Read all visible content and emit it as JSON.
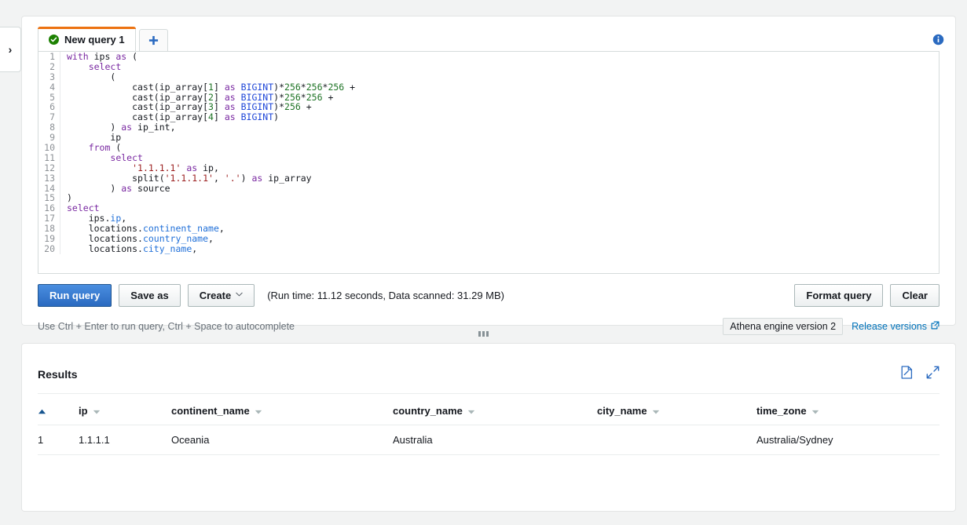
{
  "left_rail": {
    "icon": "chevron-right-icon",
    "label": "›"
  },
  "editor": {
    "info_icon": "info-circle-icon",
    "tabs": [
      {
        "label": "New query 1",
        "status_icon": "check-circle-icon",
        "active": true
      }
    ],
    "add_tab": {
      "icon": "plus-icon",
      "label": "+"
    },
    "code_lines": [
      {
        "n": "1",
        "tokens": [
          {
            "t": "with ",
            "c": "kw"
          },
          {
            "t": "ips ",
            "c": ""
          },
          {
            "t": "as",
            "c": "kw"
          },
          {
            "t": " (",
            "c": ""
          }
        ]
      },
      {
        "n": "2",
        "tokens": [
          {
            "t": "    ",
            "c": ""
          },
          {
            "t": "select",
            "c": "kw"
          }
        ]
      },
      {
        "n": "3",
        "tokens": [
          {
            "t": "        (",
            "c": ""
          }
        ]
      },
      {
        "n": "4",
        "tokens": [
          {
            "t": "            cast(ip_array[",
            "c": ""
          },
          {
            "t": "1",
            "c": "num"
          },
          {
            "t": "] ",
            "c": ""
          },
          {
            "t": "as",
            "c": "kw"
          },
          {
            "t": " ",
            "c": ""
          },
          {
            "t": "BIGINT",
            "c": "typ"
          },
          {
            "t": ")*",
            "c": ""
          },
          {
            "t": "256",
            "c": "num"
          },
          {
            "t": "*",
            "c": ""
          },
          {
            "t": "256",
            "c": "num"
          },
          {
            "t": "*",
            "c": ""
          },
          {
            "t": "256",
            "c": "num"
          },
          {
            "t": " +",
            "c": ""
          }
        ]
      },
      {
        "n": "5",
        "tokens": [
          {
            "t": "            cast(ip_array[",
            "c": ""
          },
          {
            "t": "2",
            "c": "num"
          },
          {
            "t": "] ",
            "c": ""
          },
          {
            "t": "as",
            "c": "kw"
          },
          {
            "t": " ",
            "c": ""
          },
          {
            "t": "BIGINT",
            "c": "typ"
          },
          {
            "t": ")*",
            "c": ""
          },
          {
            "t": "256",
            "c": "num"
          },
          {
            "t": "*",
            "c": ""
          },
          {
            "t": "256",
            "c": "num"
          },
          {
            "t": " +",
            "c": ""
          }
        ]
      },
      {
        "n": "6",
        "tokens": [
          {
            "t": "            cast(ip_array[",
            "c": ""
          },
          {
            "t": "3",
            "c": "num"
          },
          {
            "t": "] ",
            "c": ""
          },
          {
            "t": "as",
            "c": "kw"
          },
          {
            "t": " ",
            "c": ""
          },
          {
            "t": "BIGINT",
            "c": "typ"
          },
          {
            "t": ")*",
            "c": ""
          },
          {
            "t": "256",
            "c": "num"
          },
          {
            "t": " +",
            "c": ""
          }
        ]
      },
      {
        "n": "7",
        "tokens": [
          {
            "t": "            cast(ip_array[",
            "c": ""
          },
          {
            "t": "4",
            "c": "num"
          },
          {
            "t": "] ",
            "c": ""
          },
          {
            "t": "as",
            "c": "kw"
          },
          {
            "t": " ",
            "c": ""
          },
          {
            "t": "BIGINT",
            "c": "typ"
          },
          {
            "t": ")",
            "c": ""
          }
        ]
      },
      {
        "n": "8",
        "tokens": [
          {
            "t": "        ) ",
            "c": ""
          },
          {
            "t": "as",
            "c": "kw"
          },
          {
            "t": " ip_int,",
            "c": ""
          }
        ]
      },
      {
        "n": "9",
        "tokens": [
          {
            "t": "        ip",
            "c": ""
          }
        ]
      },
      {
        "n": "10",
        "tokens": [
          {
            "t": "    ",
            "c": ""
          },
          {
            "t": "from",
            "c": "kw"
          },
          {
            "t": " (",
            "c": ""
          }
        ]
      },
      {
        "n": "11",
        "tokens": [
          {
            "t": "        ",
            "c": ""
          },
          {
            "t": "select",
            "c": "kw"
          }
        ]
      },
      {
        "n": "12",
        "tokens": [
          {
            "t": "            ",
            "c": ""
          },
          {
            "t": "'1.1.1.1'",
            "c": "str"
          },
          {
            "t": " ",
            "c": ""
          },
          {
            "t": "as",
            "c": "kw"
          },
          {
            "t": " ip,",
            "c": ""
          }
        ]
      },
      {
        "n": "13",
        "tokens": [
          {
            "t": "            split(",
            "c": ""
          },
          {
            "t": "'1.1.1.1'",
            "c": "str"
          },
          {
            "t": ", ",
            "c": ""
          },
          {
            "t": "'.'",
            "c": "str"
          },
          {
            "t": ") ",
            "c": ""
          },
          {
            "t": "as",
            "c": "kw"
          },
          {
            "t": " ip_array",
            "c": ""
          }
        ]
      },
      {
        "n": "14",
        "tokens": [
          {
            "t": "        ) ",
            "c": ""
          },
          {
            "t": "as",
            "c": "kw"
          },
          {
            "t": " source",
            "c": ""
          }
        ]
      },
      {
        "n": "15",
        "tokens": [
          {
            "t": ")",
            "c": ""
          }
        ]
      },
      {
        "n": "16",
        "tokens": [
          {
            "t": "select",
            "c": "kw"
          }
        ]
      },
      {
        "n": "17",
        "tokens": [
          {
            "t": "    ips.",
            "c": ""
          },
          {
            "t": "ip",
            "c": "fld"
          },
          {
            "t": ",",
            "c": ""
          }
        ]
      },
      {
        "n": "18",
        "tokens": [
          {
            "t": "    locations.",
            "c": ""
          },
          {
            "t": "continent_name",
            "c": "fld"
          },
          {
            "t": ",",
            "c": ""
          }
        ]
      },
      {
        "n": "19",
        "tokens": [
          {
            "t": "    locations.",
            "c": ""
          },
          {
            "t": "country_name",
            "c": "fld"
          },
          {
            "t": ",",
            "c": ""
          }
        ]
      },
      {
        "n": "20",
        "tokens": [
          {
            "t": "    locations.",
            "c": ""
          },
          {
            "t": "city_name",
            "c": "fld"
          },
          {
            "t": ",",
            "c": ""
          }
        ]
      }
    ],
    "buttons": {
      "run": "Run query",
      "save_as": "Save as",
      "create": "Create",
      "create_caret": "ˇ",
      "format_query": "Format query",
      "clear": "Clear"
    },
    "run_stats": "(Run time: 11.12 seconds, Data scanned: 31.29 MB)",
    "hint": "Use Ctrl + Enter to run query, Ctrl + Space to autocomplete",
    "engine_version": "Athena engine version 2",
    "release_link": "Release versions",
    "release_link_icon": "external-link-icon"
  },
  "drag_handle": {
    "icon": "resize-grip-icon"
  },
  "results": {
    "title": "Results",
    "download_icon": "download-file-icon",
    "expand_icon": "expand-icon",
    "sort_icon": "sort-ascending-icon",
    "column_menu_icon": "caret-down-icon",
    "columns": [
      "",
      "ip",
      "continent_name",
      "country_name",
      "city_name",
      "time_zone"
    ],
    "rows": [
      {
        "index": "1",
        "ip": "1.1.1.1",
        "continent_name": "Oceania",
        "country_name": "Australia",
        "city_name": "",
        "time_zone": "Australia/Sydney"
      }
    ]
  },
  "colors": {
    "page_bg": "#f2f3f3",
    "accent_orange": "#ec7211",
    "link_blue": "#0073bb",
    "primary_button": "#2a6ac0",
    "success_green": "#1d8102"
  }
}
